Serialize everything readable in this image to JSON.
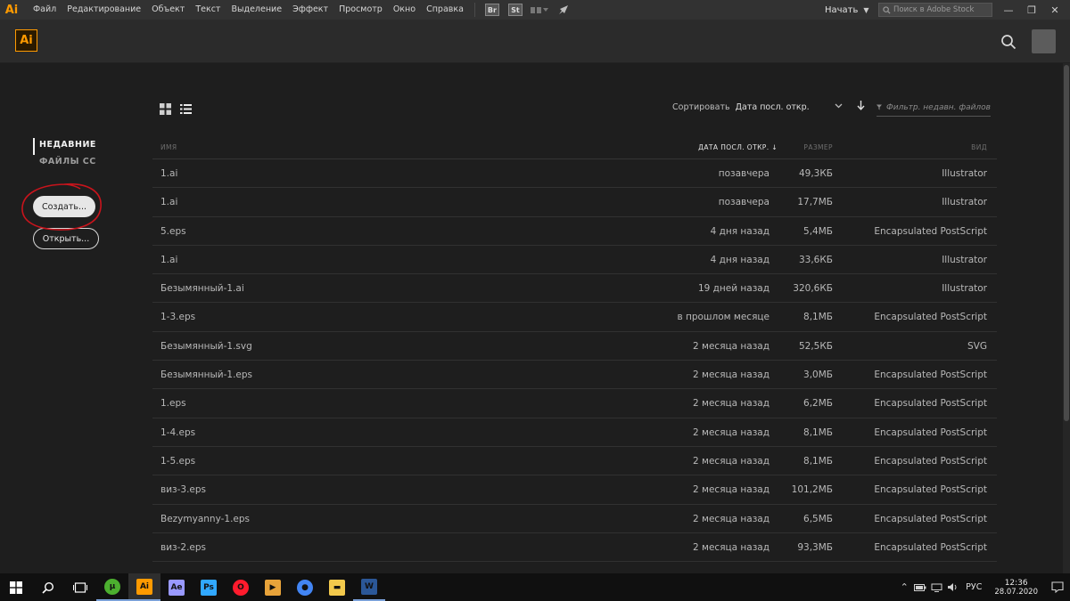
{
  "menubar": {
    "app_badge": "Ai",
    "items": [
      "Файл",
      "Редактирование",
      "Объект",
      "Текст",
      "Выделение",
      "Эффект",
      "Просмотр",
      "Окно",
      "Справка"
    ],
    "bridge_label": "Br",
    "stock_label": "St",
    "workspace_label": "Начать",
    "stock_search_placeholder": "Поиск в Adobe Stock"
  },
  "home": {
    "logo_text": "Ai"
  },
  "leftnav": {
    "items": [
      {
        "label": "НЕДАВНИЕ",
        "active": true
      },
      {
        "label": "ФАЙЛЫ CC",
        "active": false
      }
    ],
    "create_button": "Создать...",
    "open_button": "Открыть..."
  },
  "toolbar": {
    "sort_label": "Сортировать",
    "sort_value": "Дата посл. откр.",
    "filter_placeholder": "Фильтр. недавн. файлов"
  },
  "table": {
    "columns": {
      "name": "ИМЯ",
      "date": "ДАТА ПОСЛ. ОТКР.",
      "size": "РАЗМЕР",
      "kind": "ВИД"
    },
    "rows": [
      {
        "name": "1.ai",
        "date": "позавчера",
        "size": "49,3КБ",
        "kind": "Illustrator"
      },
      {
        "name": "1.ai",
        "date": "позавчера",
        "size": "17,7МБ",
        "kind": "Illustrator"
      },
      {
        "name": "5.eps",
        "date": "4 дня назад",
        "size": "5,4МБ",
        "kind": "Encapsulated PostScript"
      },
      {
        "name": "1.ai",
        "date": "4 дня назад",
        "size": "33,6КБ",
        "kind": "Illustrator"
      },
      {
        "name": "Безымянный-1.ai",
        "date": "19 дней назад",
        "size": "320,6КБ",
        "kind": "Illustrator"
      },
      {
        "name": "1-3.eps",
        "date": "в прошлом месяце",
        "size": "8,1МБ",
        "kind": "Encapsulated PostScript"
      },
      {
        "name": "Безымянный-1.svg",
        "date": "2 месяца назад",
        "size": "52,5КБ",
        "kind": "SVG"
      },
      {
        "name": "Безымянный-1.eps",
        "date": "2 месяца назад",
        "size": "3,0МБ",
        "kind": "Encapsulated PostScript"
      },
      {
        "name": "1.eps",
        "date": "2 месяца назад",
        "size": "6,2МБ",
        "kind": "Encapsulated PostScript"
      },
      {
        "name": "1-4.eps",
        "date": "2 месяца назад",
        "size": "8,1МБ",
        "kind": "Encapsulated PostScript"
      },
      {
        "name": "1-5.eps",
        "date": "2 месяца назад",
        "size": "8,1МБ",
        "kind": "Encapsulated PostScript"
      },
      {
        "name": "виз-3.eps",
        "date": "2 месяца назад",
        "size": "101,2МБ",
        "kind": "Encapsulated PostScript"
      },
      {
        "name": "Bezymyanny-1.eps",
        "date": "2 месяца назад",
        "size": "6,5МБ",
        "kind": "Encapsulated PostScript"
      },
      {
        "name": "виз-2.eps",
        "date": "2 месяца назад",
        "size": "93,3МБ",
        "kind": "Encapsulated PostScript"
      },
      {
        "name": "",
        "date": "",
        "size": "",
        "kind": ""
      }
    ]
  },
  "taskbar": {
    "apps": [
      {
        "name": "utorrent",
        "label": "µ",
        "color": "#4caf2f"
      },
      {
        "name": "illustrator",
        "label": "Ai",
        "color": "#ff9a00",
        "active": true
      },
      {
        "name": "after-effects",
        "label": "Ae",
        "color": "#9999ff"
      },
      {
        "name": "photoshop",
        "label": "Ps",
        "color": "#31a8ff"
      },
      {
        "name": "opera",
        "label": "O",
        "color": "#ff1b2d"
      },
      {
        "name": "media-player",
        "label": "▶",
        "color": "#e8a33a"
      },
      {
        "name": "chrome",
        "label": "●",
        "color": "#4285f4"
      },
      {
        "name": "file-explorer",
        "label": "▬",
        "color": "#f2c94c"
      },
      {
        "name": "word",
        "label": "W",
        "color": "#2b5797"
      }
    ],
    "language": "РУС",
    "time": "12:36",
    "date": "28.07.2020"
  }
}
